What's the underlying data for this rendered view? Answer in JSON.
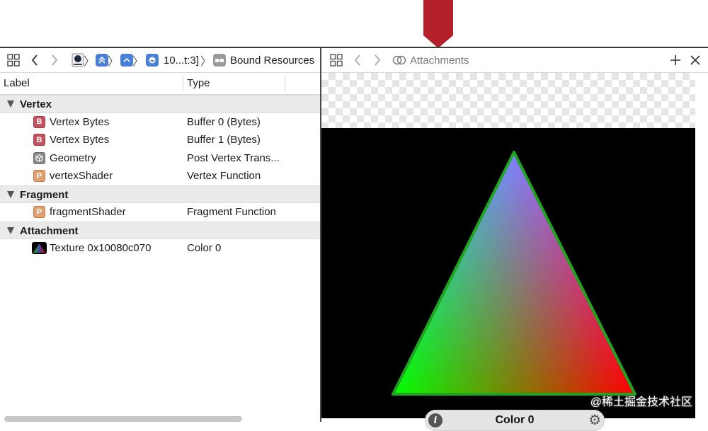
{
  "left_panel": {
    "breadcrumb": {
      "frame_label": "10...t:3]",
      "current": "Bound Resources"
    },
    "columns": {
      "label": "Label",
      "type": "Type"
    },
    "groups": [
      {
        "name": "Vertex",
        "items": [
          {
            "badge": "B",
            "label": "Vertex Bytes",
            "type": "Buffer 0 (Bytes)"
          },
          {
            "badge": "B",
            "label": "Vertex Bytes",
            "type": "Buffer 1 (Bytes)"
          },
          {
            "badge": "geometry-icon",
            "label": "Geometry",
            "type": "Post Vertex Trans..."
          },
          {
            "badge": "P",
            "label": "vertexShader",
            "type": "Vertex Function"
          }
        ]
      },
      {
        "name": "Fragment",
        "items": [
          {
            "badge": "P",
            "label": "fragmentShader",
            "type": "Fragment Function"
          }
        ]
      },
      {
        "name": "Attachment",
        "items": [
          {
            "badge": "texture-thumbnail",
            "label": "Texture 0x10080c070",
            "type": "Color 0"
          }
        ]
      }
    ]
  },
  "right_panel": {
    "title": "Attachments",
    "attachment_label": "Color 0"
  },
  "watermark": "@稀土掘金技术社区",
  "colors": {
    "buffer_badge": "#c7525f",
    "program_badge": "#e0a070",
    "geometry_badge": "#8a8a8a",
    "toolbar_blue": "#4a7fd8",
    "marker_red": "#b3202a",
    "triangle_outline": "#1fa51f"
  }
}
